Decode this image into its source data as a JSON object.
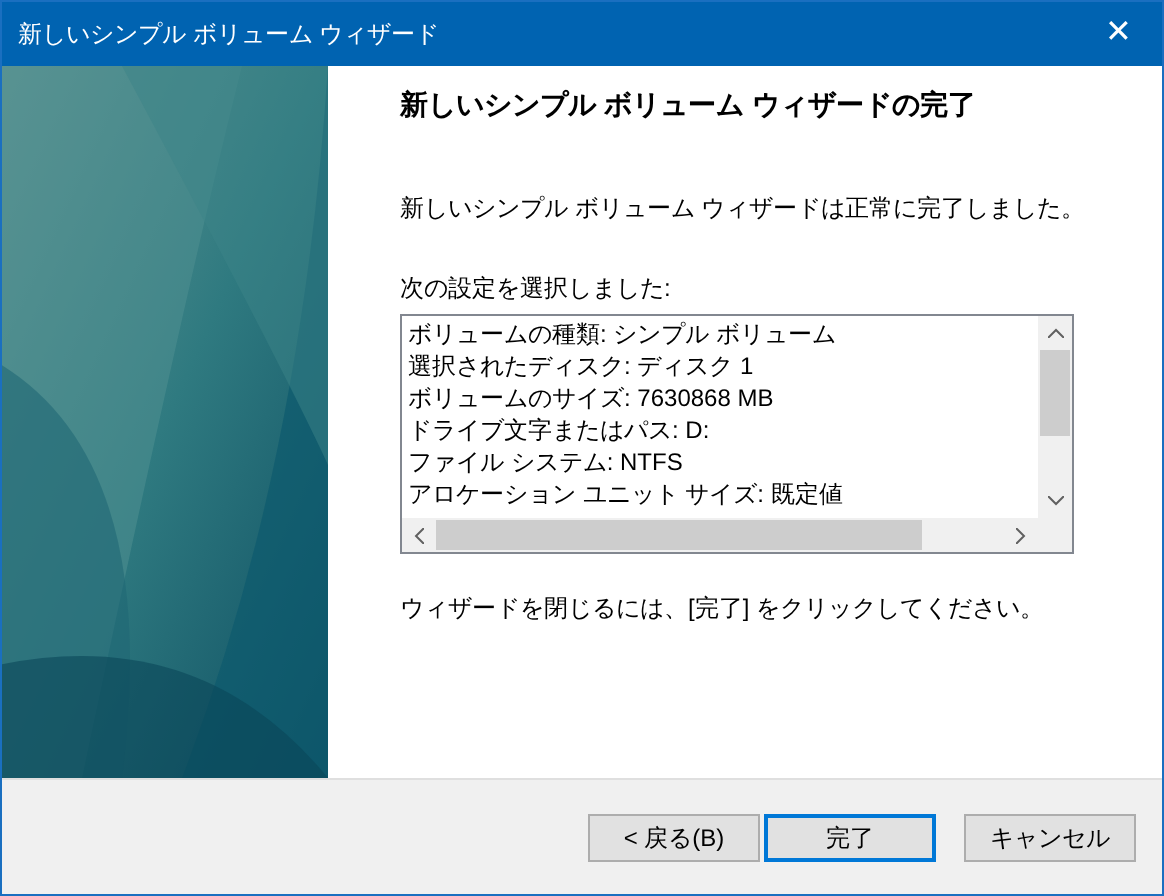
{
  "window": {
    "title": "新しいシンプル ボリューム ウィザード",
    "close": "✕"
  },
  "heading": "新しいシンプル ボリューム ウィザードの完了",
  "message": "新しいシンプル ボリューム ウィザードは正常に完了しました。",
  "settings_label": "次の設定を選択しました:",
  "settings": [
    "ボリュームの種類: シンプル ボリューム",
    "選択されたディスク: ディスク 1",
    "ボリュームのサイズ: 7630868 MB",
    "ドライブ文字またはパス: D:",
    "ファイル システム: NTFS",
    "アロケーション ユニット サイズ: 既定値"
  ],
  "hint": "ウィザードを閉じるには、[完了] をクリックしてください。",
  "buttons": [
    {
      "label": "< 戻る(B)",
      "default": false
    },
    {
      "label": "完了",
      "default": true
    },
    {
      "label": "キャンセル",
      "default": false
    }
  ]
}
